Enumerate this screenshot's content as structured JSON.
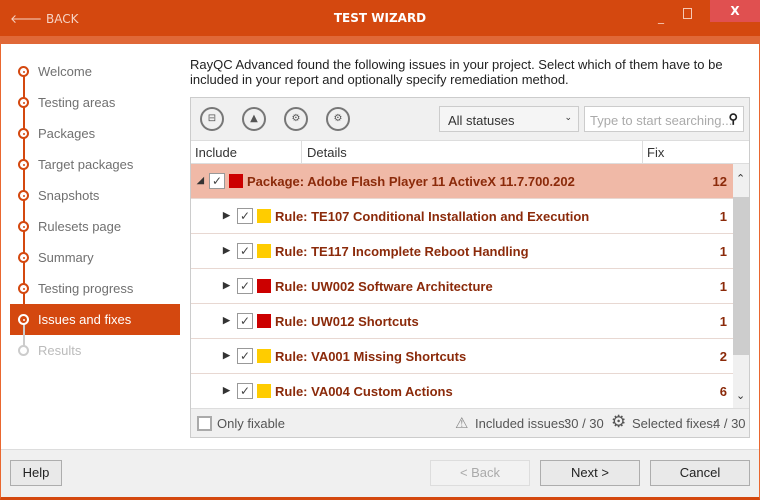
{
  "titlebar": {
    "back": "BACK",
    "title": "TEST WIZARD",
    "close": "X"
  },
  "steps": [
    {
      "label": "Welcome",
      "state": "done"
    },
    {
      "label": "Testing areas",
      "state": "done"
    },
    {
      "label": "Packages",
      "state": "done"
    },
    {
      "label": "Target packages",
      "state": "done"
    },
    {
      "label": "Snapshots",
      "state": "done"
    },
    {
      "label": "Rulesets page",
      "state": "done"
    },
    {
      "label": "Summary",
      "state": "done"
    },
    {
      "label": "Testing progress",
      "state": "done"
    },
    {
      "label": "Issues and fixes",
      "state": "active"
    },
    {
      "label": "Results",
      "state": "disabled"
    }
  ],
  "description": "RayQC Advanced found the following issues in your project. Select which of them have to be included in your report and optionally specify remediation method.",
  "toolbar": {
    "status_filter": "All statuses",
    "search_placeholder": "Type to start searching..."
  },
  "columns": {
    "include": "Include",
    "details": "Details",
    "fix": "Fix"
  },
  "package": {
    "label": "Package: Adobe Flash Player 11 ActiveX 11.7.700.202",
    "fix": "12",
    "color": "#cc0000",
    "checked": true
  },
  "rules": [
    {
      "label": "Rule: TE107 Conditional Installation and Execution",
      "fix": "1",
      "color": "#ffcc00"
    },
    {
      "label": "Rule: TE117 Incomplete Reboot Handling",
      "fix": "1",
      "color": "#ffcc00"
    },
    {
      "label": "Rule: UW002 Software Architecture",
      "fix": "1",
      "color": "#cc0000"
    },
    {
      "label": "Rule: UW012 Shortcuts",
      "fix": "1",
      "color": "#cc0000"
    },
    {
      "label": "Rule: VA001 Missing Shortcuts",
      "fix": "2",
      "color": "#ffcc00"
    },
    {
      "label": "Rule: VA004 Custom Actions",
      "fix": "6",
      "color": "#ffcc00"
    }
  ],
  "footer": {
    "only_fixable": "Only fixable",
    "included_label": "Included issues:",
    "included": "30 / 30",
    "fixes_label": "Selected fixes:",
    "fixes": "4 / 30"
  },
  "buttons": {
    "help": "Help",
    "back": "< Back",
    "next": "Next >",
    "cancel": "Cancel"
  }
}
